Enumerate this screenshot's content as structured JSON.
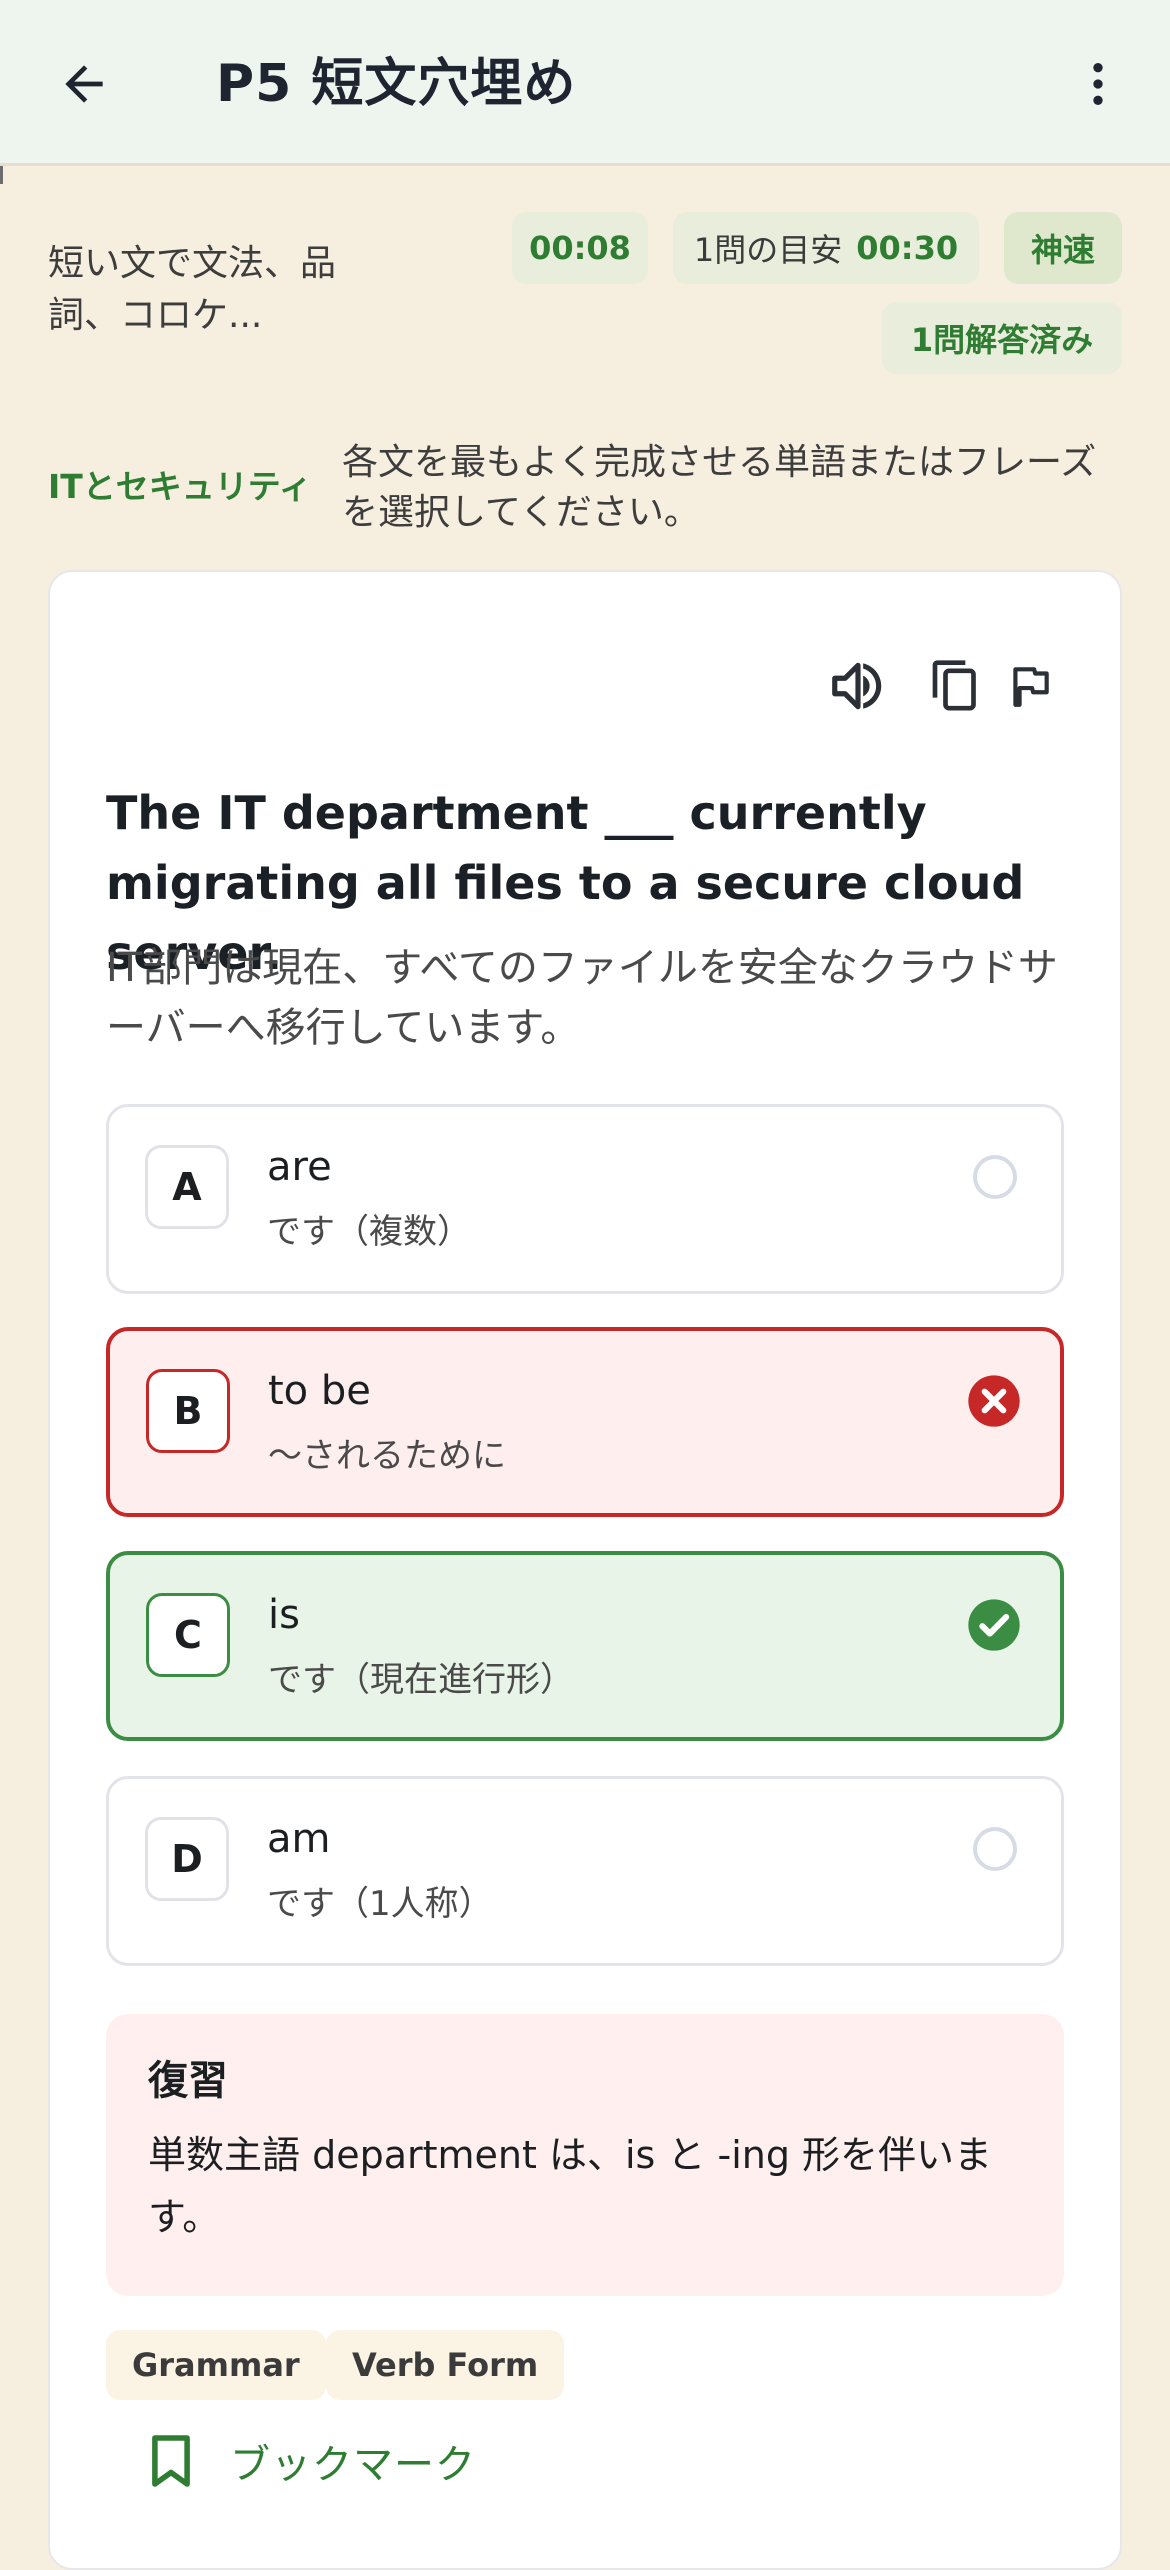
{
  "header": {
    "title": "P5 短文穴埋め"
  },
  "stats": {
    "set_description": "短い文で文法、品詞、コロケ...",
    "timer": "00:08",
    "target_label": "1問の目安",
    "target_value": "00:30",
    "speed_badge": "神速",
    "answered": "1問解答済み"
  },
  "category": "ITとセキュリティ",
  "instruction": "各文を最もよく完成させる単語またはフレーズを選択してください。",
  "question": {
    "text": "The IT department ___ currently migrating all files to a secure cloud server.",
    "translation": "IT部門は現在、すべてのファイルを安全なクラウドサーバーへ移行しています。"
  },
  "options": [
    {
      "letter": "A",
      "word": "are",
      "meaning": "です（複数）",
      "state": "unselected"
    },
    {
      "letter": "B",
      "word": "to be",
      "meaning": "〜されるために",
      "state": "wrong"
    },
    {
      "letter": "C",
      "word": "is",
      "meaning": "です（現在進行形）",
      "state": "correct"
    },
    {
      "letter": "D",
      "word": "am",
      "meaning": "です（1人称）",
      "state": "unselected"
    }
  ],
  "review": {
    "title": "復習",
    "body": "単数主語 department は、is と -ing 形を伴います。"
  },
  "tags": [
    "Grammar",
    "Verb Form"
  ],
  "bookmark_label": "ブックマーク",
  "icons": {
    "back": "arrow-back-icon",
    "more": "more-vert-icon",
    "speaker": "speaker-icon",
    "copy": "copy-icon",
    "flag": "flag-icon",
    "bookmark": "bookmark-icon",
    "wrong": "error-circle-icon",
    "correct": "check-circle-icon"
  },
  "colors": {
    "accent_green": "#2e7d32",
    "wrong_red": "#c62828",
    "page_bg": "#f6efe0",
    "appbar_bg": "#eef4ee"
  }
}
